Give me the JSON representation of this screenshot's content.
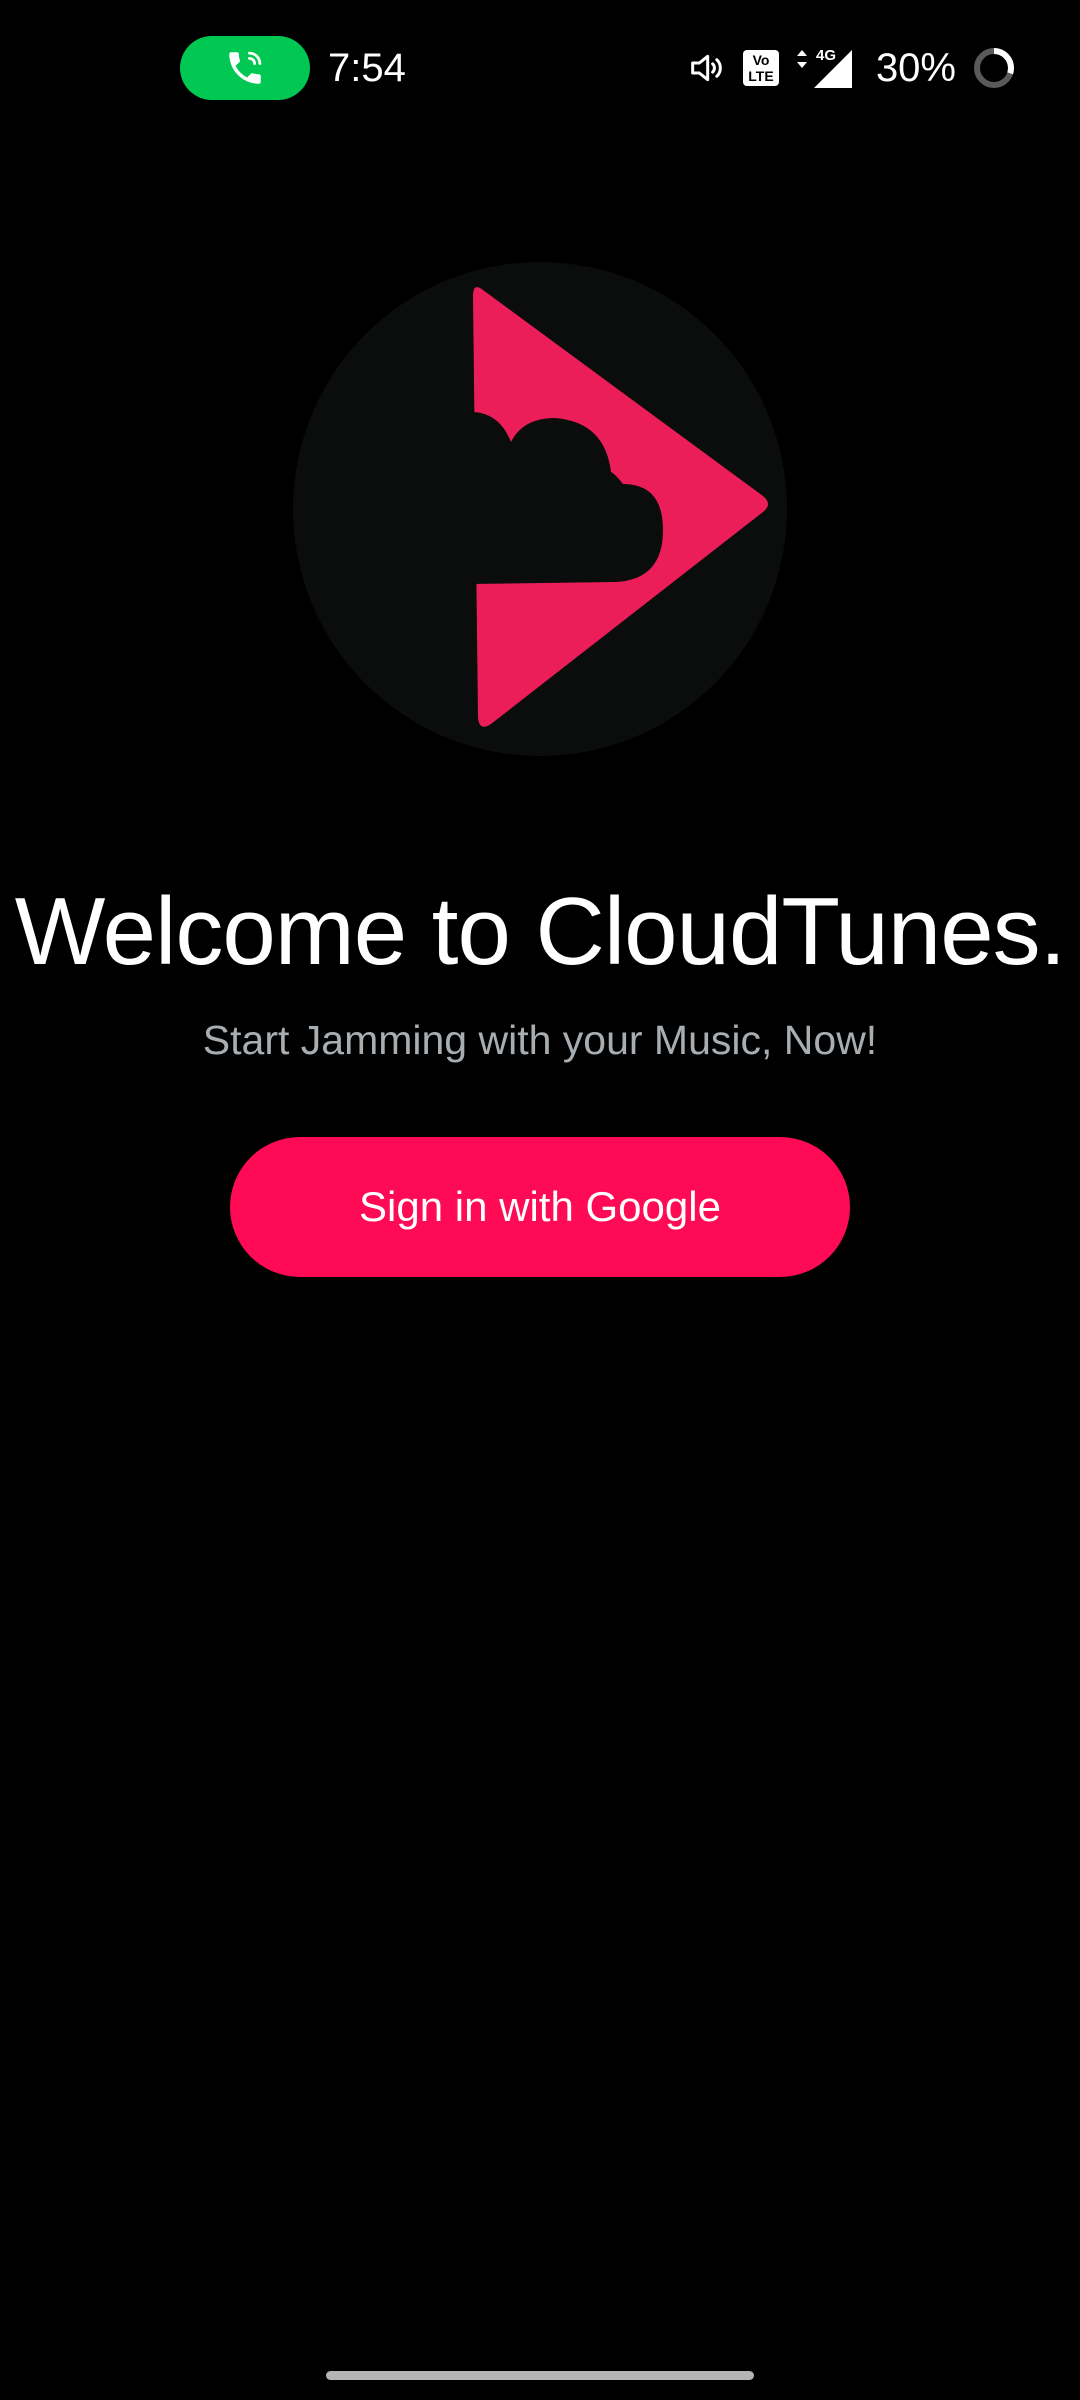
{
  "status_bar": {
    "time": "7:54",
    "battery_percent": "30%",
    "battery_level": 0.3,
    "network_badge": "4G",
    "volte_line1": "Vo",
    "volte_line2": "LTE",
    "call_pill_color": "#00c853",
    "icons": [
      "phone-call-icon",
      "speaker-icon",
      "volte-icon",
      "signal-icon",
      "battery-ring-icon"
    ]
  },
  "welcome": {
    "title": "Welcome to CloudTunes.",
    "subtitle": "Start Jamming with your Music, Now!"
  },
  "auth": {
    "google_button_label": "Sign in with Google"
  },
  "colors": {
    "background": "#000000",
    "brand_accent": "#ff0a54",
    "logo_play": "#ec1e5a",
    "logo_circle": "#0b0c0c",
    "subtitle": "#a8adb2"
  }
}
